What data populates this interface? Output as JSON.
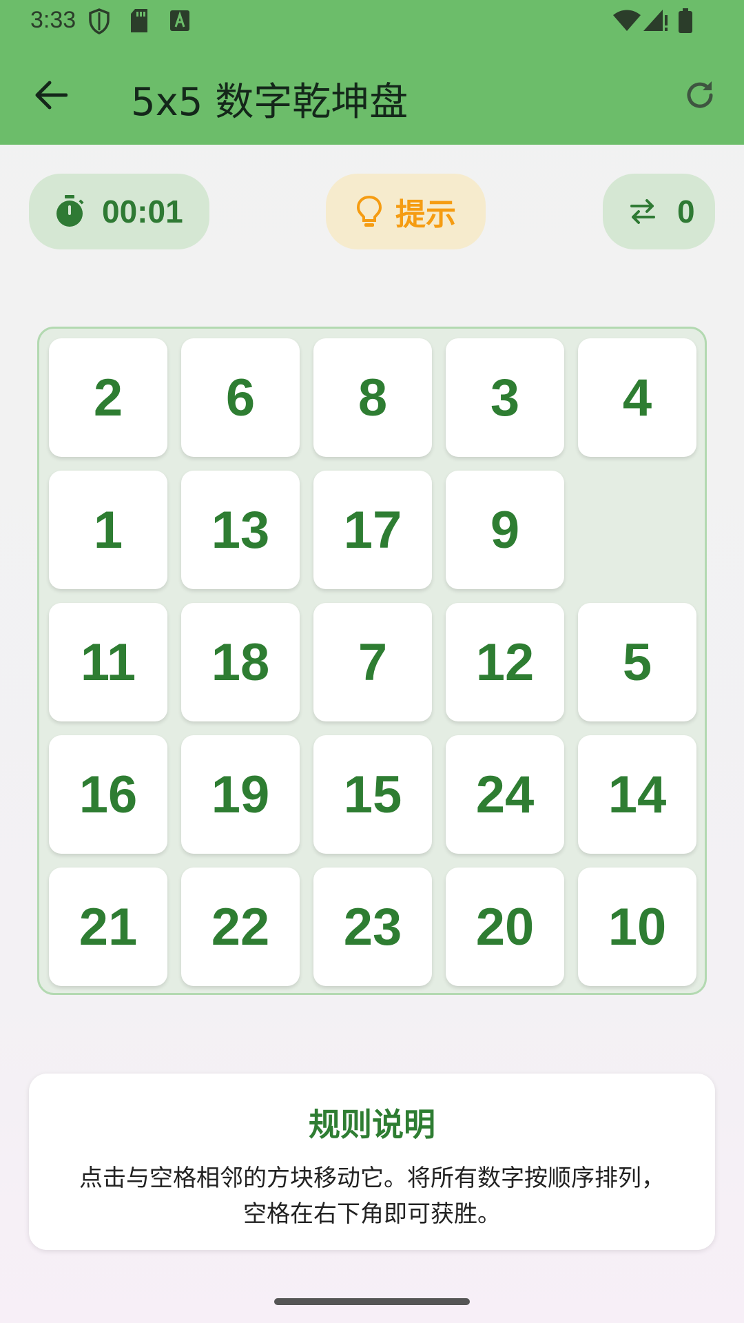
{
  "status_bar": {
    "time": "3:33",
    "left_icons": [
      "shield-icon",
      "sd-card-icon",
      "font-a-icon"
    ],
    "right_icons": [
      "wifi-icon",
      "cell-signal-icon",
      "battery-icon"
    ]
  },
  "toolbar": {
    "title": "5x5 数字乾坤盘",
    "back_icon": "arrow-left-icon",
    "refresh_icon": "refresh-icon"
  },
  "stats": {
    "timer": "00:01",
    "hint_label": "提示",
    "moves": "0"
  },
  "board": {
    "size": 5,
    "tiles": [
      [
        "2",
        "6",
        "8",
        "3",
        "4"
      ],
      [
        "1",
        "13",
        "17",
        "9",
        ""
      ],
      [
        "11",
        "18",
        "7",
        "12",
        "5"
      ],
      [
        "16",
        "19",
        "15",
        "24",
        "14"
      ],
      [
        "21",
        "22",
        "23",
        "20",
        "10"
      ]
    ]
  },
  "rules": {
    "title": "规则说明",
    "body": "点击与空格相邻的方块移动它。将所有数字按顺序排列，空格在右下角即可获胜。"
  },
  "colors": {
    "app_bar": "#6cbd6a",
    "accent_green": "#2e7d32",
    "hint_orange": "#f59c12",
    "pill_green": "#d5e7d3",
    "pill_yellow": "#f6ebcd"
  }
}
